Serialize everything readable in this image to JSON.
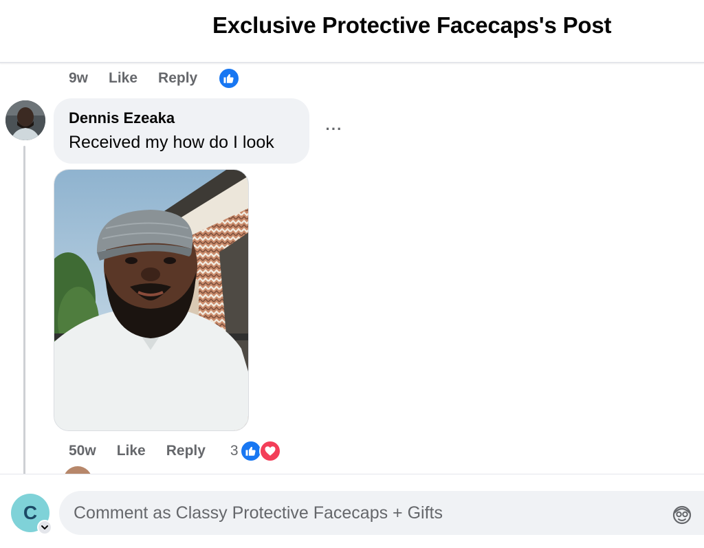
{
  "header": {
    "title": "Exclusive Protective Facecaps's Post"
  },
  "previous_comment": {
    "time": "9w",
    "like_label": "Like",
    "reply_label": "Reply",
    "reaction_icon": "like-icon"
  },
  "comment": {
    "author": "Dennis Ezeaka",
    "text": "Received my how do I look",
    "more_label": "···",
    "time": "50w",
    "like_label": "Like",
    "reply_label": "Reply",
    "reaction_count": "3",
    "reactions": [
      "like-icon",
      "love-icon"
    ]
  },
  "composer": {
    "avatar_letter": "C",
    "placeholder": "Comment as Classy Protective Facecaps + Gifts",
    "emoji_icon": "sticker-face-icon"
  },
  "colors": {
    "like_blue": "#1877f2",
    "love_red": "#f33e58",
    "bubble_bg": "#f0f2f5",
    "meta_gray": "#65676b"
  }
}
